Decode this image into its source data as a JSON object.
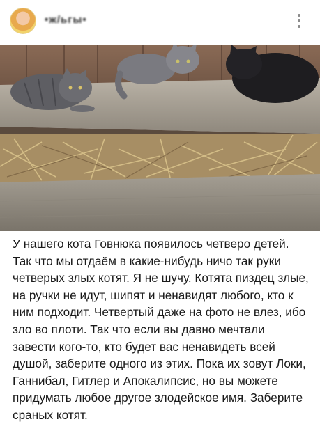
{
  "post": {
    "author": "•ж/ьгы•",
    "menu_icon": "more-vert-icon",
    "text": "У нашего кота Говнюка появилось четверо детей. Так что мы отдаём в какие-нибудь ничо так руки четверых злых котят. Я не шучу. Котята пиздец злые, на ручки не идут, шипят и ненавидят любого, кто к ним подходит. Четвертый даже на фото не влез, ибо зло во плоти. Так что если вы давно мечтали завести кого-то, кто будет вас ненавидеть всей душой, заберите одного из этих. Пока их зовут Локи, Ганнибал, Гитлер и Апокалипсис, но вы можете придумать любое другое злодейское имя. Заберите сраных котят."
  },
  "colors": {
    "background": "#ffffff",
    "text": "#1a1a1a",
    "menu_dots": "#8a8a8a"
  }
}
